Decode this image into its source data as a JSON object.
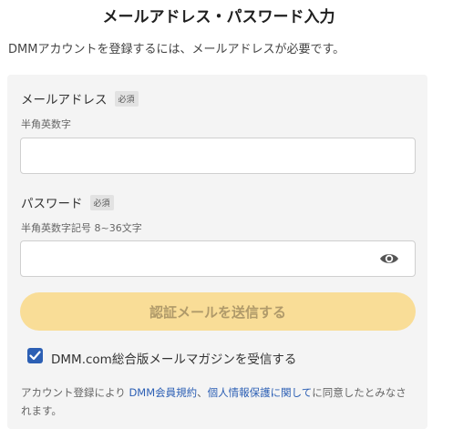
{
  "header": {
    "title": "メールアドレス・パスワード入力",
    "intro": "DMMアカウントを登録するには、メールアドレスが必要です。"
  },
  "form": {
    "email": {
      "label": "メールアドレス",
      "required_badge": "必須",
      "hint": "半角英数字",
      "value": "",
      "placeholder": ""
    },
    "password": {
      "label": "パスワード",
      "required_badge": "必須",
      "hint": "半角英数字記号 8~36文字",
      "value": "",
      "placeholder": "",
      "toggle_icon": "eye-icon"
    },
    "submit_label": "認証メールを送信する",
    "newsletter": {
      "checked": true,
      "label": "DMM.com総合版メールマガジンを受信する"
    },
    "terms": {
      "prefix": "アカウント登録により ",
      "link1": "DMM会員規約",
      "sep": "、",
      "link2": "個人情報保護に関して",
      "suffix": "に同意したとみなされます。"
    }
  },
  "colors": {
    "panel_bg": "#f4f4f4",
    "submit_bg": "#f9dd97",
    "checkbox_bg": "#2c5fb4",
    "link": "#2c5fb4"
  }
}
